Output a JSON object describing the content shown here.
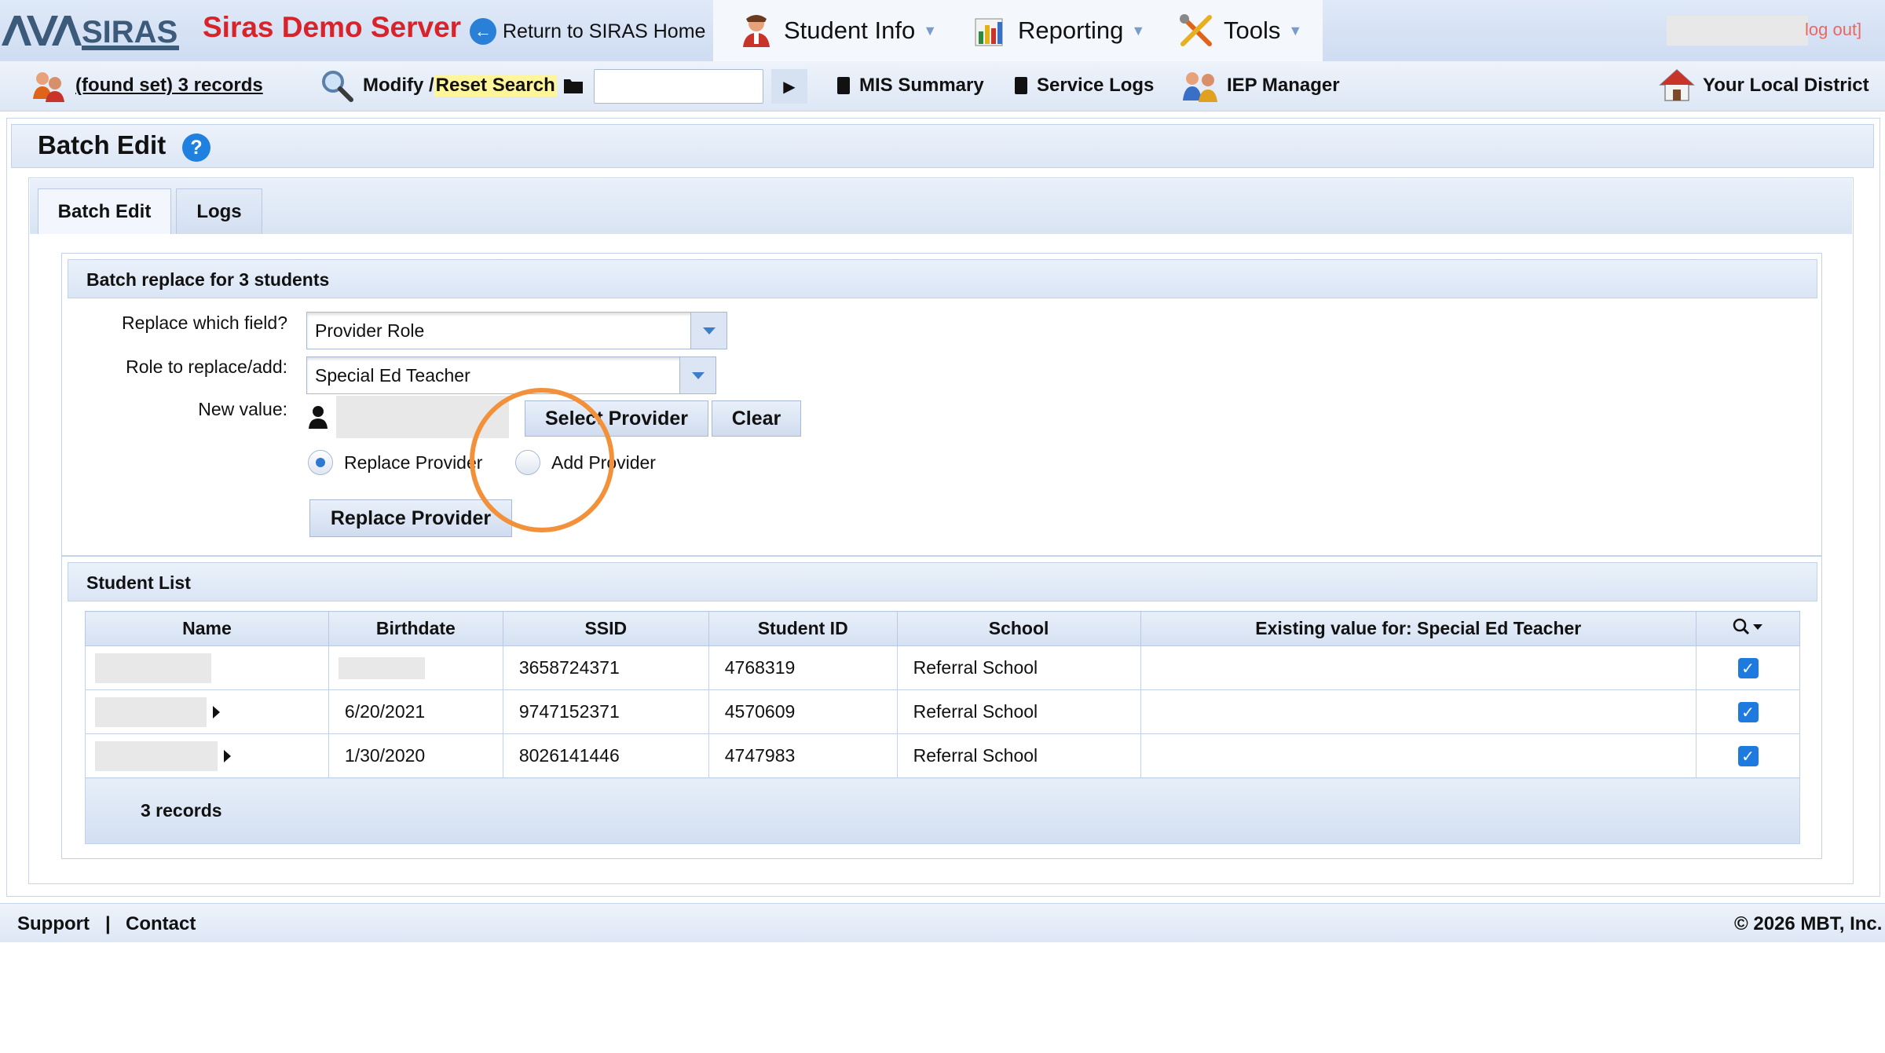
{
  "header": {
    "logo_text": "SIRAS",
    "app_title": "Siras Demo Server",
    "return_home": "Return to SIRAS Home",
    "menu": [
      {
        "label": "Student Info",
        "icon": "student-icon"
      },
      {
        "label": "Reporting",
        "icon": "reporting-icon"
      },
      {
        "label": "Tools",
        "icon": "tools-icon"
      }
    ],
    "logout": "log out]"
  },
  "toolbar": {
    "found_set": "(found set) 3 records",
    "modify": "Modify / ",
    "reset_search": "Reset Search",
    "search_value": "",
    "mis_summary": "MIS Summary",
    "service_logs": "Service Logs",
    "iep_manager": "IEP Manager",
    "local_district": "Your Local District"
  },
  "page": {
    "title": "Batch Edit",
    "help": "?",
    "tabs": [
      {
        "label": "Batch Edit",
        "active": true
      },
      {
        "label": "Logs",
        "active": false
      }
    ]
  },
  "batch": {
    "title": "Batch replace for 3 students",
    "field_label": "Replace which field?",
    "field_value": "Provider Role",
    "role_label": "Role to replace/add:",
    "role_value": "Special Ed Teacher",
    "new_value_label": "New value:",
    "select_provider": "Select Provider",
    "clear": "Clear",
    "radio_replace": "Replace Provider",
    "radio_add": "Add Provider",
    "selected_radio": "Replace Provider",
    "submit": "Replace Provider"
  },
  "student_list": {
    "title": "Student List",
    "columns": [
      "Name",
      "Birthdate",
      "SSID",
      "Student ID",
      "School",
      "Existing value for: Special Ed Teacher"
    ],
    "rows": [
      {
        "birthdate": "",
        "ssid": "3658724371",
        "student_id": "4768319",
        "school": "Referral School",
        "existing": "",
        "checked": true
      },
      {
        "birthdate": "6/20/2021",
        "ssid": "9747152371",
        "student_id": "4570609",
        "school": "Referral School",
        "existing": "",
        "checked": true
      },
      {
        "birthdate": "1/30/2020",
        "ssid": "8026141446",
        "student_id": "4747983",
        "school": "Referral School",
        "existing": "",
        "checked": true
      }
    ],
    "footer": "3 records"
  },
  "footer": {
    "support": "Support",
    "separator": "|",
    "contact": "Contact",
    "copyright": "© 2026 MBT, Inc."
  },
  "colors": {
    "title_red": "#d8232a",
    "accent_blue": "#1f80e0",
    "highlight_orange": "#f2913a",
    "reset_highlight": "#fff59a"
  }
}
